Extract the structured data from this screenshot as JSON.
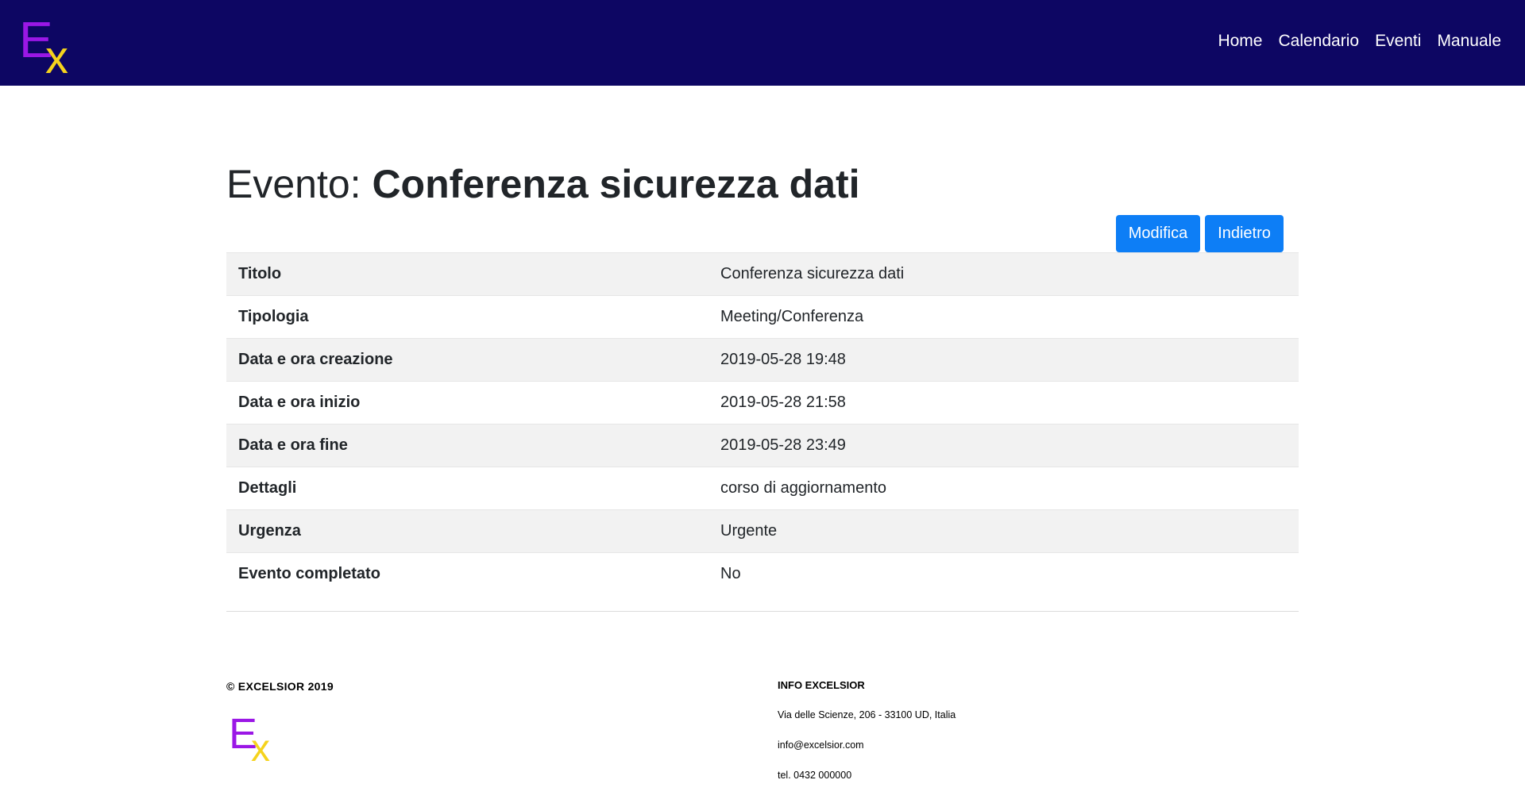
{
  "brand": {
    "logo_e": "E",
    "logo_x": "x",
    "colors": {
      "navbar": "#0d0663",
      "logo_e": "#9b17e6",
      "logo_x": "#f5d31d",
      "button": "#0d7ef6"
    }
  },
  "nav": {
    "items": [
      {
        "label": "Home"
      },
      {
        "label": "Calendario"
      },
      {
        "label": "Eventi"
      },
      {
        "label": "Manuale"
      }
    ]
  },
  "page": {
    "title_prefix": "Evento: ",
    "title_name": "Conferenza sicurezza dati"
  },
  "actions": {
    "edit_label": "Modifica",
    "back_label": "Indietro"
  },
  "details": [
    {
      "key": "Titolo",
      "value": "Conferenza sicurezza dati"
    },
    {
      "key": "Tipologia",
      "value": "Meeting/Conferenza"
    },
    {
      "key": "Data e ora creazione",
      "value": "2019-05-28 19:48"
    },
    {
      "key": "Data e ora inizio",
      "value": "2019-05-28 21:58"
    },
    {
      "key": "Data e ora fine",
      "value": "2019-05-28 23:49"
    },
    {
      "key": "Dettagli",
      "value": "corso di aggiornamento"
    },
    {
      "key": "Urgenza",
      "value": "Urgente"
    },
    {
      "key": "Evento completato",
      "value": "No"
    }
  ],
  "footer": {
    "copyright": "© EXCELSIOR 2019",
    "info_title": "INFO EXCELSIOR",
    "address": "Via delle Scienze, 206 - 33100 UD, Italia",
    "email": "info@excelsior.com",
    "phone": "tel. 0432 000000"
  }
}
